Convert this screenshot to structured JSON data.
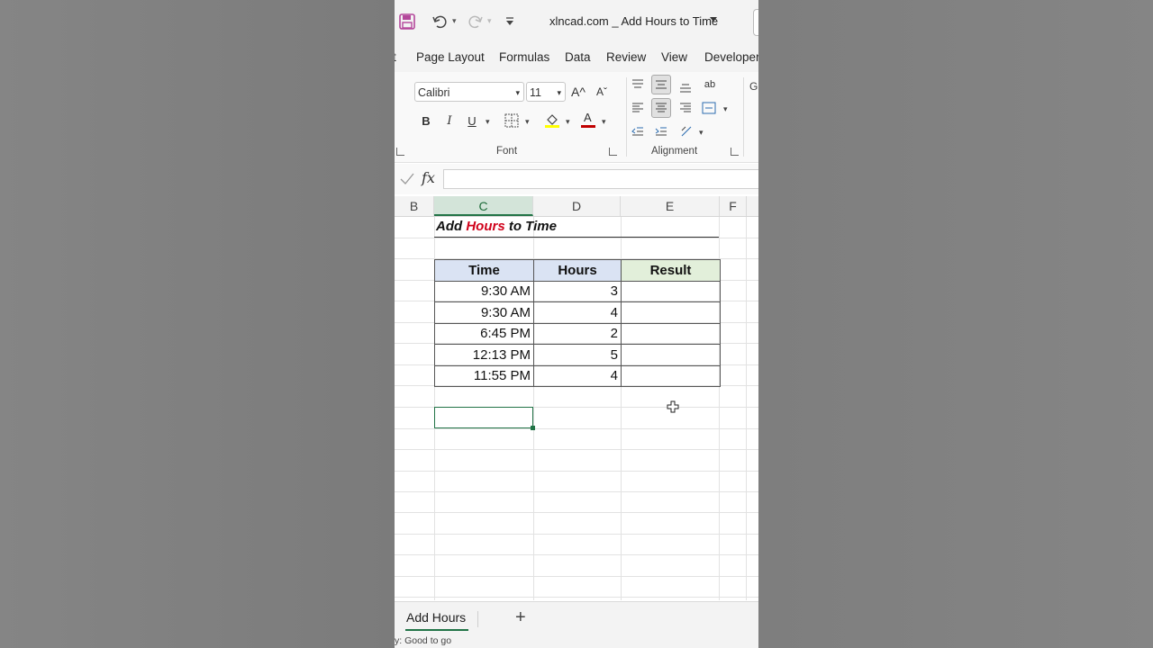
{
  "window": {
    "title": "xlncad.com _ Add Hours to Time",
    "icons": [
      "save-icon",
      "undo-icon",
      "redo-icon",
      "customize-qat-icon",
      "title-dropdown-icon"
    ]
  },
  "tabs": [
    "t",
    "Page Layout",
    "Formulas",
    "Data",
    "Review",
    "View",
    "Developer"
  ],
  "ribbon": {
    "font_name": "Calibri",
    "font_size": "11",
    "bold": "B",
    "italic": "I",
    "underline": "U",
    "grow_font": "A^",
    "shrink_font": "Aˇ",
    "font_color_letter": "A",
    "orientation_text": "ab",
    "font_group_label": "Font",
    "alignment_group_label": "Alignment",
    "clipped_group_letter": "G",
    "highlight_color": "#ffff00",
    "font_color": "#c00000"
  },
  "formula_bar": {
    "fx": "fx",
    "value": ""
  },
  "columns": [
    "B",
    "C",
    "D",
    "E",
    "F"
  ],
  "selected_column": "C",
  "sheet": {
    "title_prefix": "Add",
    "title_highlight": "Hours",
    "title_suffix": "to Time",
    "headers": {
      "time": "Time",
      "hours": "Hours",
      "result": "Result"
    },
    "rows": [
      {
        "time": "9:30 AM",
        "hours": "3",
        "result": ""
      },
      {
        "time": "9:30 AM",
        "hours": "4",
        "result": ""
      },
      {
        "time": "6:45 PM",
        "hours": "2",
        "result": ""
      },
      {
        "time": "12:13 PM",
        "hours": "5",
        "result": ""
      },
      {
        "time": "11:55 PM",
        "hours": "4",
        "result": ""
      }
    ]
  },
  "sheet_tabs": {
    "active": "Add Hours",
    "add": "+"
  },
  "status": "y: Good to go"
}
